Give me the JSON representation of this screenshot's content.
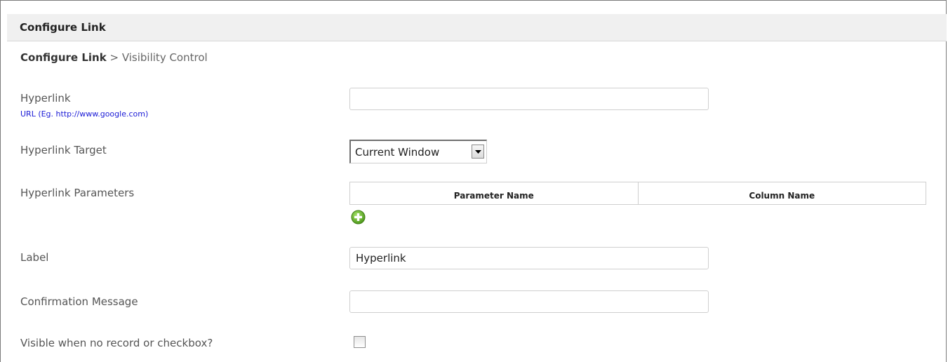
{
  "header": {
    "title": "Configure Link"
  },
  "breadcrumb": {
    "current": "Configure Link",
    "separator": ">",
    "next": "Visibility Control"
  },
  "form": {
    "hyperlink": {
      "label": "Hyperlink",
      "hint": "URL (Eg. http://www.google.com)",
      "value": ""
    },
    "hyperlink_target": {
      "label": "Hyperlink Target",
      "selected": "Current Window"
    },
    "hyperlink_parameters": {
      "label": "Hyperlink Parameters",
      "columns": [
        "Parameter Name",
        "Column Name"
      ]
    },
    "label": {
      "label": "Label",
      "value": "Hyperlink"
    },
    "confirmation_message": {
      "label": "Confirmation Message",
      "value": ""
    },
    "visible_when_none": {
      "label": "Visible when no record or checkbox?",
      "checked": false
    }
  },
  "colors": {
    "header_bg": "#f0f0f0",
    "hint_blue": "#1a1ad6",
    "add_icon_green": "#6cbf2a"
  },
  "icons": {
    "add": "plus-circle-icon",
    "dropdown": "chevron-down-icon"
  }
}
